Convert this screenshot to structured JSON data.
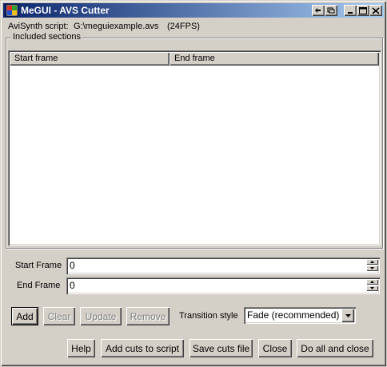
{
  "window": {
    "title": "MeGUI - AVS Cutter"
  },
  "script_info": {
    "label": "AviSynth script:",
    "path": "G:\\meguiexample.avs",
    "fps": "(24FPS)"
  },
  "sections": {
    "legend": "Included sections",
    "columns": [
      "Start frame",
      "End frame"
    ],
    "rows": []
  },
  "start_frame": {
    "label": "Start Frame",
    "value": "0"
  },
  "end_frame": {
    "label": "End Frame",
    "value": "0"
  },
  "actions": {
    "add": "Add",
    "clear": "Clear",
    "update": "Update",
    "remove": "Remove"
  },
  "transition": {
    "label": "Transition style",
    "selected": "Fade (recommended)"
  },
  "footer": {
    "help": "Help",
    "add_cuts": "Add cuts to script",
    "save_cuts": "Save cuts file",
    "close": "Close",
    "do_all": "Do all and close"
  }
}
